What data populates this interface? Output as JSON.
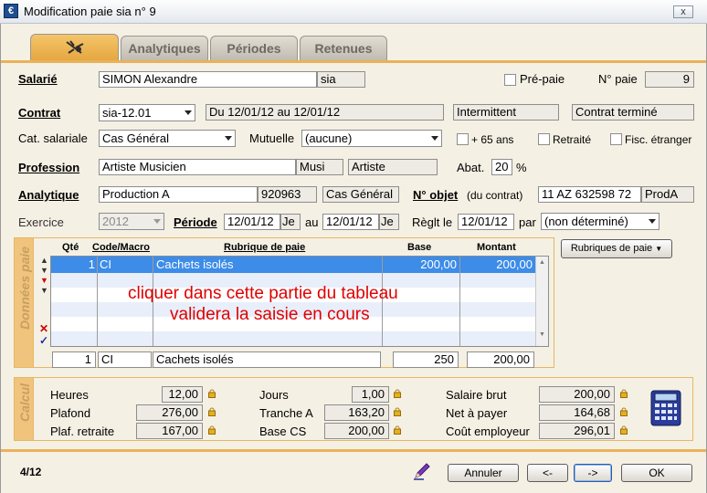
{
  "window": {
    "title": "Modification paie sia n° 9",
    "close_label": "x",
    "app_icon": "€"
  },
  "tabs": [
    {
      "label": "",
      "icon": "main-tab-icon",
      "active": true
    },
    {
      "label": "Analytiques"
    },
    {
      "label": "Périodes"
    },
    {
      "label": "Retenues"
    }
  ],
  "header": {
    "salarie_label": "Salarié",
    "salarie_name": "SIMON Alexandre",
    "salarie_code": "sia",
    "prepaie_label": "Pré-paie",
    "npaie_label": "N° paie",
    "npaie_value": "9",
    "contrat_label": "Contrat",
    "contrat_value": "sia-12.01",
    "contrat_dates": "Du 12/01/12 au 12/01/12",
    "contrat_type": "Intermittent",
    "contrat_status": "Contrat terminé",
    "cat_label": "Cat. salariale",
    "cat_value": "Cas Général",
    "mutuelle_label": "Mutuelle",
    "mutuelle_value": "(aucune)",
    "plus65_label": "+ 65 ans",
    "retraite_label": "Retraité",
    "fisc_label": "Fisc. étranger",
    "profession_label": "Profession",
    "profession_value": "Artiste Musicien",
    "profession_code": "Musi",
    "profession_cat": "Artiste",
    "abat_label": "Abat.",
    "abat_value": "20",
    "abat_unit": "%",
    "analytique_label": "Analytique",
    "analytique_value": "Production A",
    "analytique_code": "920963",
    "analytique_cat": "Cas Général",
    "nobjet_label": "N° objet",
    "nobjet_sub": "(du contrat)",
    "nobjet_value": "11 AZ 632598 72",
    "nobjet_code": "ProdA",
    "exercice_label": "Exercice",
    "exercice_value": "2012",
    "periode_label": "Période",
    "periode_from": "12/01/12",
    "periode_from_day": "Je",
    "au_label": "au",
    "periode_to": "12/01/12",
    "periode_to_day": "Je",
    "reglt_label": "Règlt le",
    "reglt_value": "12/01/12",
    "par_label": "par",
    "par_value": "(non déterminé)"
  },
  "donnees": {
    "side_label": "Données paie",
    "rubriques_button": "Rubriques de paie",
    "columns": {
      "qte": "Qté",
      "code": "Code/Macro",
      "rubrique": "Rubrique de paie",
      "base": "Base",
      "montant": "Montant"
    },
    "rows": [
      {
        "qte": "1",
        "code": "CI",
        "rubrique": "Cachets isolés",
        "base": "200,00",
        "montant": "200,00"
      }
    ],
    "overlay_line1": "cliquer dans cette partie du tableau",
    "overlay_line2": "validera la saisie en cours",
    "edit": {
      "qte": "1",
      "code": "CI",
      "rubrique": "Cachets isolés",
      "base": "250",
      "montant": "200,00"
    }
  },
  "calcul": {
    "side_label": "Calcul",
    "heures_label": "Heures",
    "heures_value": "12,00",
    "plafond_label": "Plafond",
    "plafond_value": "276,00",
    "plafret_label": "Plaf. retraite",
    "plafret_value": "167,00",
    "jours_label": "Jours",
    "jours_value": "1,00",
    "trancheA_label": "Tranche A",
    "trancheA_value": "163,20",
    "baseCS_label": "Base CS",
    "baseCS_value": "200,00",
    "brut_label": "Salaire brut",
    "brut_value": "200,00",
    "net_label": "Net à payer",
    "net_value": "164,68",
    "cout_label": "Coût employeur",
    "cout_value": "296,01"
  },
  "footer": {
    "counter": "4/12",
    "annuler": "Annuler",
    "prev": "<-",
    "next": "->",
    "ok": "OK"
  }
}
